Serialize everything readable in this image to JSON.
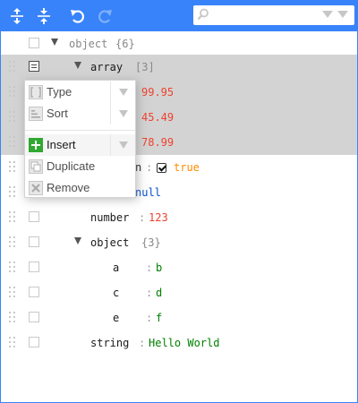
{
  "toolbar": {
    "expand_all": "expand-all-icon",
    "collapse_all": "collapse-all-icon",
    "undo": "undo-icon",
    "redo": "redo-icon",
    "search_value": "",
    "search_placeholder": ""
  },
  "tree": {
    "root": {
      "field": "object",
      "count": "{6}"
    },
    "array": {
      "field": "array",
      "count": "[3]"
    },
    "array_items": [
      "99.95",
      "45.49",
      "78.99"
    ],
    "boolean": {
      "field_visible": "n",
      "value": "true"
    },
    "null_value": "null",
    "number": {
      "field": "number",
      "value": "123"
    },
    "object": {
      "field": "object",
      "count": "{3}"
    },
    "object_items": [
      {
        "field": "a",
        "value": "b"
      },
      {
        "field": "c",
        "value": "d"
      },
      {
        "field": "e",
        "value": "f"
      }
    ],
    "string": {
      "field": "string",
      "value": "Hello World"
    },
    "separator": ":"
  },
  "context_menu": {
    "type_label": "Type",
    "sort_label": "Sort",
    "insert_label": "Insert",
    "duplicate_label": "Duplicate",
    "remove_label": "Remove"
  },
  "colors": {
    "menubar": "#3883fa",
    "number": "#ee422e",
    "boolean": "#ff8c00",
    "null": "#004ed0",
    "string": "#008000",
    "insert_icon": "#31a831"
  }
}
